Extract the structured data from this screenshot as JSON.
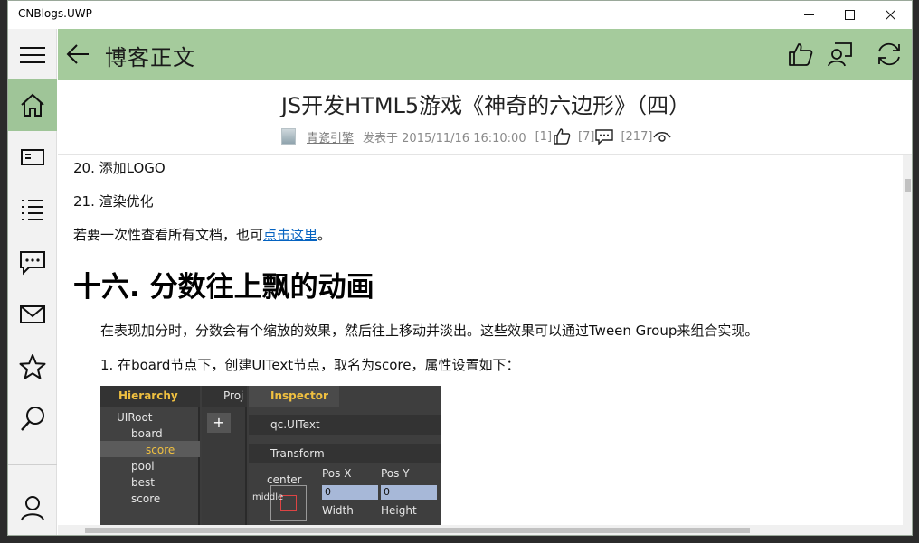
{
  "app": {
    "title": "CNBlogs.UWP"
  },
  "header": {
    "title": "博客正文"
  },
  "article": {
    "title": "JS开发HTML5游戏《神奇的六边形》（四）",
    "author": "青瓷引擎",
    "published": "发表于 2015/11/16 16:10:00",
    "likes": "[1]",
    "comments": "[7]",
    "views": "[217]"
  },
  "content": {
    "item20": "20. 添加LOGO",
    "item21": "21. 渲染优化",
    "all_docs_prefix": "若要一次性查看所有文档，也可",
    "all_docs_link": "点击这里",
    "all_docs_suffix": "。",
    "section_heading": "十六. 分数往上飘的动画",
    "para1": "在表现加分时，分数会有个缩放的效果，然后往上移动并淡出。这些效果可以通过Tween Group来组合实现。",
    "step1": "1. 在board节点下，创建UIText节点，取名为score，属性设置如下："
  },
  "screenshot": {
    "hierarchy_tab": "Hierarchy",
    "project_tab": "Proj",
    "inspector_tab": "Inspector",
    "tree": [
      "UIRoot",
      "board",
      "score",
      "pool",
      "best",
      "score"
    ],
    "component1": "qc.UIText",
    "component2": "Transform",
    "anchor_label": "center",
    "anchor_vlabel": "middle",
    "pos_x_label": "Pos X",
    "pos_y_label": "Pos Y",
    "pos_x_value": "0",
    "pos_y_value": "0",
    "width_label": "Width",
    "height_label": "Height",
    "plus": "+"
  },
  "colors": {
    "accent": "#a5cb9c",
    "sidebar_active": "#9fc598",
    "link": "#0563c1"
  },
  "icons": {
    "sidebar": [
      "hamburger-icon",
      "home-icon",
      "news-icon",
      "list-icon",
      "chat-icon",
      "mail-icon",
      "star-icon",
      "search-icon",
      "user-icon"
    ],
    "header": [
      "back-arrow-icon",
      "thumbs-up-icon",
      "comment-icon",
      "refresh-icon"
    ]
  }
}
